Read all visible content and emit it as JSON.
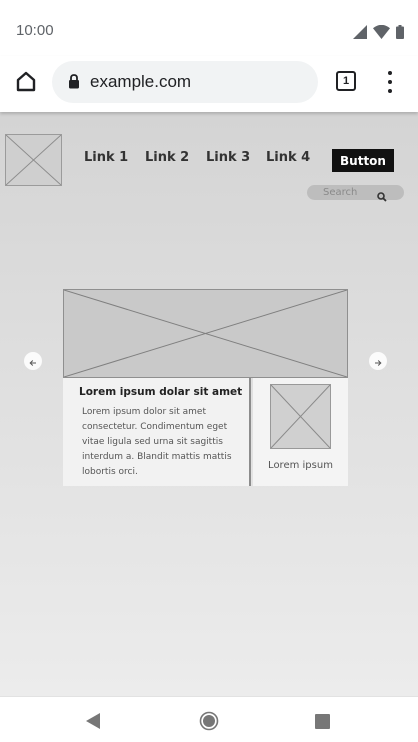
{
  "status_bar": {
    "time": "10:00",
    "icons": [
      "signal-icon",
      "wifi-icon",
      "battery-icon"
    ]
  },
  "browser": {
    "url": "example.com",
    "tab_count": "1",
    "icons": [
      "home-icon",
      "lock-icon",
      "tabs-icon",
      "more-vert-icon"
    ]
  },
  "page": {
    "nav_links": [
      "Link 1",
      "Link 2",
      "Link 3",
      "Link 4"
    ],
    "nav_button": "Button",
    "search": {
      "placeholder": "Search",
      "value": ""
    },
    "card": {
      "title": "Lorem ipsum dolar sit amet",
      "body": "Lorem ipsum dolor sit amet consectetur. Condimentum eget vitae ligula sed urna sit sagittis interdum a. Blandit mattis mattis lobortis orci.",
      "side_caption": "Lorem ipsum"
    },
    "carousel_icons": [
      "arrow-left-icon",
      "arrow-right-icon"
    ]
  },
  "system_nav": {
    "icons": [
      "back-icon",
      "home-circle-icon",
      "recents-icon"
    ]
  },
  "colors": {
    "page_bg_top": "#d4d4d4",
    "page_bg_bottom": "#ececec",
    "button_bg": "#111111",
    "url_pill_bg": "#f1f3f4"
  }
}
